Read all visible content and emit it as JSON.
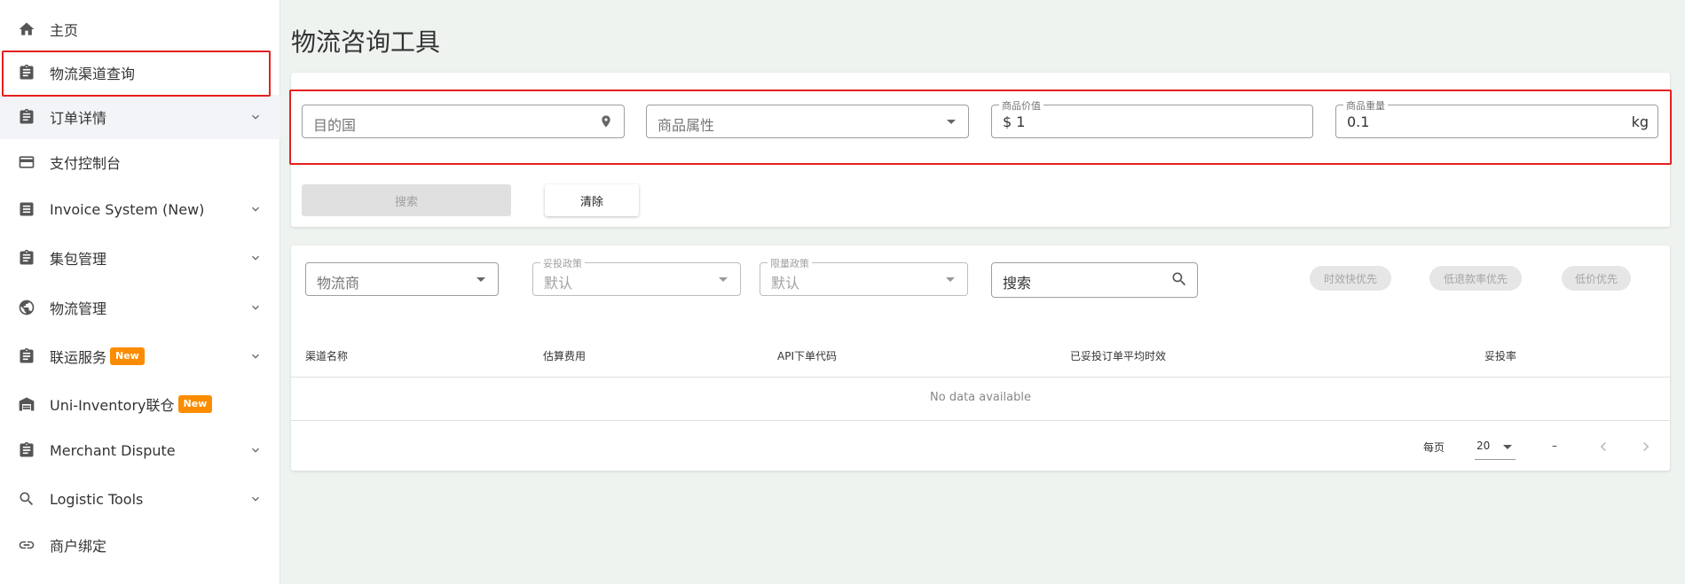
{
  "sidebar": {
    "items": [
      {
        "label": "主页"
      },
      {
        "label": "物流渠道查询"
      },
      {
        "label": "订单详情"
      },
      {
        "label": "支付控制台"
      },
      {
        "label": "Invoice System (New)"
      },
      {
        "label": "集包管理"
      },
      {
        "label": "物流管理"
      },
      {
        "label": "联运服务",
        "badge": "New"
      },
      {
        "label": "Uni-Inventory联仓",
        "badge": "New"
      },
      {
        "label": "Merchant Dispute"
      },
      {
        "label": "Logistic Tools"
      },
      {
        "label": "商户绑定"
      }
    ]
  },
  "page": {
    "title": "物流咨询工具"
  },
  "form": {
    "destination_placeholder": "目的国",
    "attribute_placeholder": "商品属性",
    "value_label": "商品价值",
    "value": "$ 1",
    "weight_label": "商品重量",
    "weight": "0.1",
    "weight_unit": "kg",
    "search_label": "搜索",
    "clear_label": "清除"
  },
  "filters": {
    "carrier_placeholder": "物流商",
    "delivery_policy_label": "妥投政策",
    "delivery_policy_value": "默认",
    "weight_policy_label": "限量政策",
    "weight_policy_value": "默认",
    "search_placeholder": "搜索",
    "sort_speed": "时效快优先",
    "sort_refund": "低退款率优先",
    "sort_price": "低价优先"
  },
  "table": {
    "headers": [
      "渠道名称",
      "估算费用",
      "API下单代码",
      "已妥投订单平均时效",
      "妥投率"
    ],
    "empty_text": "No data available"
  },
  "pagination": {
    "per_page_label": "每页",
    "per_page": "20",
    "range": "–"
  },
  "colors": {
    "highlight": "#e52020",
    "badge": "#fb8c00"
  }
}
